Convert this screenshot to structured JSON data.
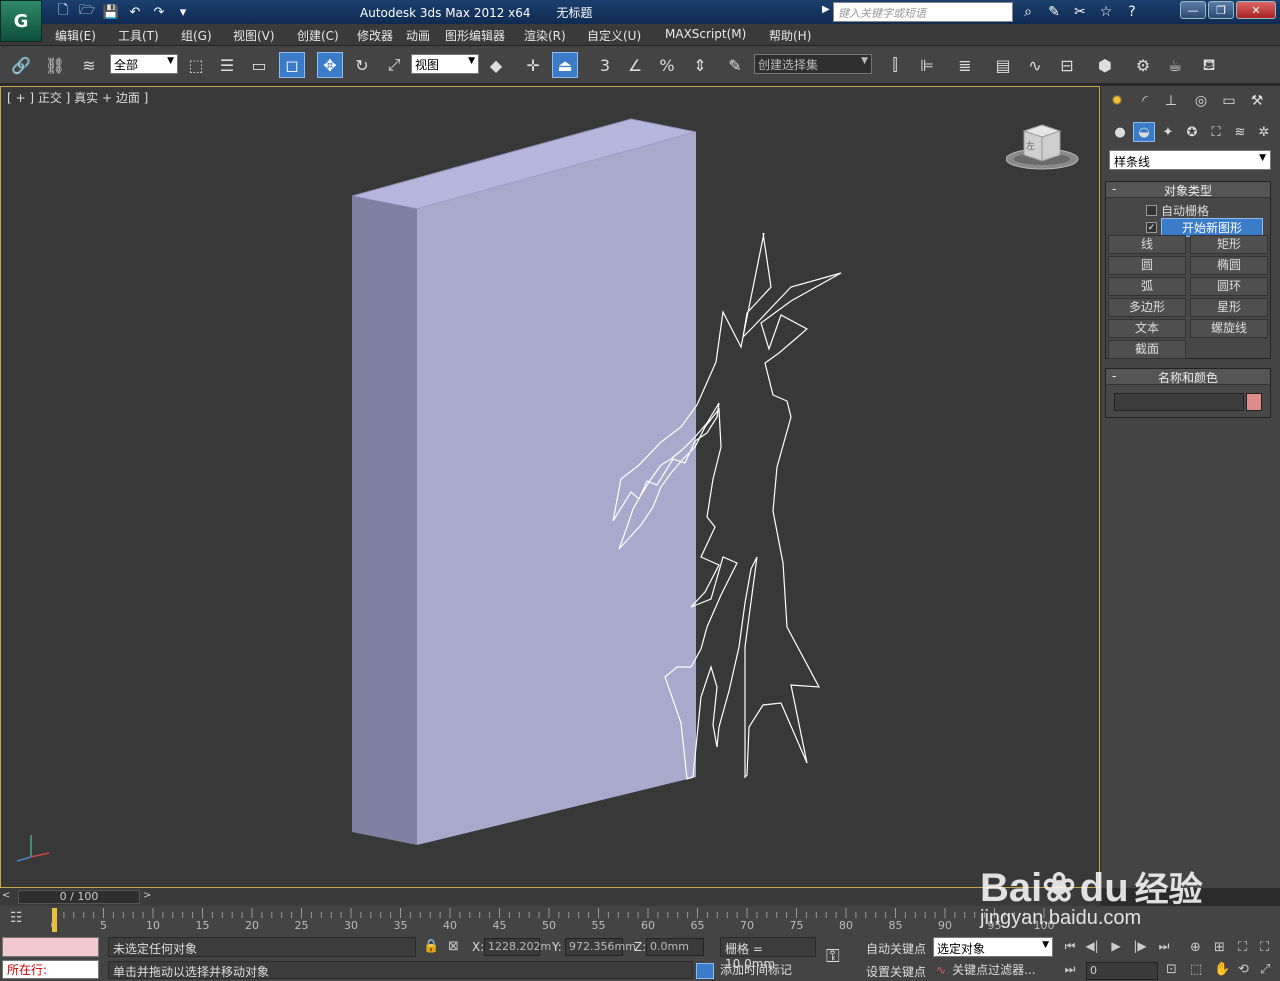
{
  "app": {
    "logo_glyph": "G",
    "title": "Autodesk 3ds Max  2012 x64",
    "document": "无标题",
    "search_placeholder": "键入关键字或短语"
  },
  "quick_access": [
    "new-icon",
    "open-icon",
    "save-icon",
    "undo-icon",
    "redo-icon",
    "customize-icon"
  ],
  "window_controls": {
    "minimize": "—",
    "restore": "❐",
    "close": "✕"
  },
  "menus": [
    "编辑(E)",
    "工具(T)",
    "组(G)",
    "视图(V)",
    "创建(C)",
    "修改器",
    "动画",
    "图形编辑器",
    "渲染(R)",
    "自定义(U)",
    "MAXScript(M)",
    "帮助(H)"
  ],
  "toolbar": {
    "selection_filter": "全部",
    "reference_coord": "视图",
    "named_selection": "创建选择集",
    "snap_3_label": "3",
    "percent_label": "%"
  },
  "viewport": {
    "label": "[ + ] 正交 ] 真实 + 边面 ]",
    "viewcube_text": "左"
  },
  "command_panel": {
    "category": "样条线",
    "object_type_title": "对象类型",
    "auto_grid": "自动栅格",
    "start_new_shape": "开始新图形",
    "start_new_shape_checked": "✓",
    "buttons": [
      "线",
      "矩形",
      "圆",
      "椭圆",
      "弧",
      "圆环",
      "多边形",
      "星形",
      "文本",
      "螺旋线",
      "截面"
    ],
    "name_color_title": "名称和颜色",
    "swatch_color": "#e08a8a"
  },
  "time_slider": {
    "position": "0 / 100",
    "left_arrow": "<",
    "right_arrow": ">"
  },
  "track_ticks": [
    "0",
    "5",
    "10",
    "15",
    "20",
    "25",
    "30",
    "35",
    "40",
    "45",
    "50",
    "55",
    "60",
    "65",
    "70",
    "75",
    "80",
    "85",
    "90",
    "95",
    "100"
  ],
  "status": {
    "selection": "未选定任何对象",
    "prompt": "单击并拖动以选择并移动对象",
    "running": "所在行:",
    "x_label": "X:",
    "x_value": "1228.202m",
    "y_label": "Y:",
    "y_value": "972.356mm",
    "z_label": "Z:",
    "z_value": "0.0mm",
    "grid": "栅格 = 10.0mm",
    "add_time_tag": "添加时间标记",
    "auto_key": "自动关键点",
    "set_key": "设置关键点",
    "selected_object": "选定对象",
    "key_filter": "关键点过滤器...",
    "frame": "0"
  },
  "watermark": {
    "brand": "Bai",
    "brand2": "du",
    "cn": "经验",
    "url": "jingyan.baidu.com"
  },
  "colors": {
    "box_front": "#a9a9cc",
    "box_side": "#8080a2",
    "box_top": "#b6b6dc",
    "spline": "#ffffff",
    "viewport_border": "#c9a64a",
    "active_blue": "#3b7cc9"
  }
}
